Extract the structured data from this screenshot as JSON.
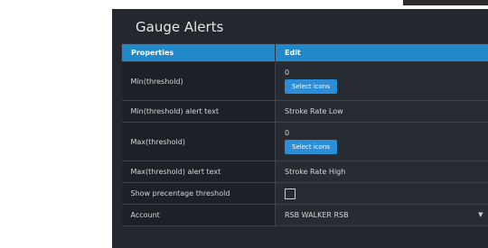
{
  "panel": {
    "title": "Gauge Alerts",
    "table": {
      "headers": [
        "Properties",
        "Edit"
      ],
      "rows": [
        {
          "label": "Min(threshold)",
          "value": "0",
          "button": "Select icons"
        },
        {
          "label": "Min(threshold) alert text",
          "value": "Stroke Rate Low"
        },
        {
          "label": "Max(threshold)",
          "value": "0",
          "button": "Select icons"
        },
        {
          "label": "Max(threshold) alert text",
          "value": "Stroke Rate High"
        },
        {
          "label": "Show precentage threshold",
          "checked": false
        },
        {
          "label": "Account",
          "value": "RSB WALKER RSB"
        }
      ]
    }
  },
  "icons": {
    "dropdown": "chevron-down-icon"
  },
  "colors": {
    "header": "#2188c9",
    "button": "#2b8ed6",
    "panel": "#24272d"
  }
}
